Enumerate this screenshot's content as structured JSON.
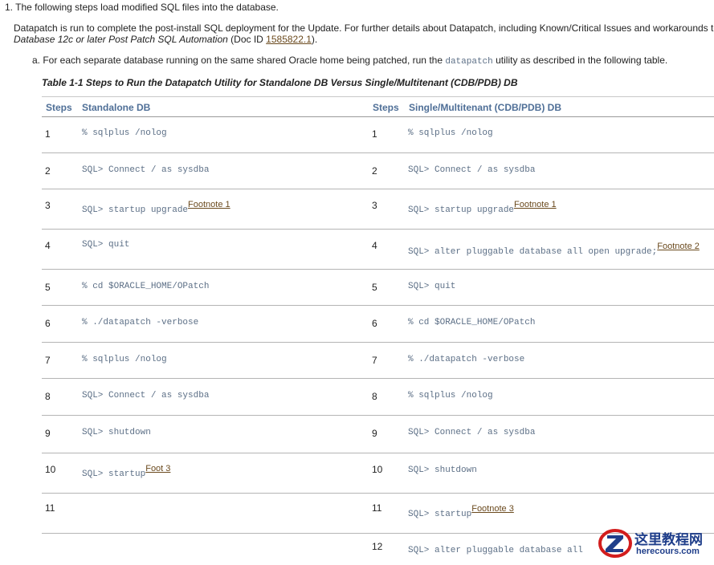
{
  "intro": {
    "line1": "1. The following steps load modified SQL files into the database.",
    "line2": "Datapatch is run to complete the post-install SQL deployment for the Update. For further details about Datapatch, including Known/Critical Issues and workarounds to comm",
    "line3_italic": "Database 12c or later Post Patch SQL Automation",
    "line3_doc": " (Doc ID ",
    "line3_link": "1585822.1",
    "line3_end": ").",
    "line4_pre": "a. For each separate database running on the same shared Oracle home being patched, run the ",
    "line4_code": "datapatch",
    "line4_post": " utility as described in the following table."
  },
  "table": {
    "caption": "Table 1-1 Steps to Run the Datapatch Utility for Standalone DB Versus Single/Multitenant (CDB/PDB) DB",
    "headers": {
      "steps_left": "Steps",
      "standalone": "Standalone DB",
      "steps_right": "Steps",
      "multitenant": "Single/Multitenant (CDB/PDB) DB"
    },
    "rows": [
      {
        "ln": "1",
        "lc": "% sqlplus /nolog",
        "lf": "",
        "rn": "1",
        "rc": "% sqlplus /nolog",
        "rf": ""
      },
      {
        "ln": "2",
        "lc": "SQL> Connect / as sysdba",
        "lf": "",
        "rn": "2",
        "rc": "SQL> Connect / as sysdba",
        "rf": ""
      },
      {
        "ln": "3",
        "lc": "SQL> startup upgrade",
        "lf": "Footnote 1",
        "rn": "3",
        "rc": "SQL> startup upgrade",
        "rf": "Footnote 1"
      },
      {
        "ln": "4",
        "lc": "SQL> quit",
        "lf": "",
        "rn": "4",
        "rc": "SQL> alter pluggable database all open upgrade;",
        "rf": "Footnote 2"
      },
      {
        "ln": "5",
        "lc": "% cd $ORACLE_HOME/OPatch",
        "lf": "",
        "rn": "5",
        "rc": "SQL> quit",
        "rf": ""
      },
      {
        "ln": "6",
        "lc": "% ./datapatch -verbose",
        "lf": "",
        "rn": "6",
        "rc": "% cd $ORACLE_HOME/OPatch",
        "rf": ""
      },
      {
        "ln": "7",
        "lc": "% sqlplus /nolog",
        "lf": "",
        "rn": "7",
        "rc": "% ./datapatch -verbose",
        "rf": ""
      },
      {
        "ln": "8",
        "lc": "SQL> Connect / as sysdba",
        "lf": "",
        "rn": "8",
        "rc": "% sqlplus /nolog",
        "rf": ""
      },
      {
        "ln": "9",
        "lc": "SQL> shutdown",
        "lf": "",
        "rn": "9",
        "rc": "SQL> Connect / as sysdba",
        "rf": ""
      },
      {
        "ln": "10",
        "lc": "SQL> startup",
        "lf": "Foot 3",
        "rn": "10",
        "rc": "SQL> shutdown",
        "rf": ""
      },
      {
        "ln": "11",
        "lc": "",
        "lf": "",
        "rn": "11",
        "rc": "SQL> startup",
        "rf": "Footnote 3"
      },
      {
        "ln": "",
        "lc": "",
        "lf": "",
        "rn": "12",
        "rc": "SQL> alter pluggable database all",
        "rf": ""
      }
    ]
  },
  "watermark": {
    "cn": "这里教程网",
    "en": "herecours.com"
  }
}
